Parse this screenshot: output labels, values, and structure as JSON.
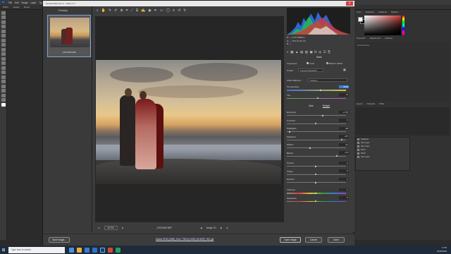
{
  "photoshop": {
    "logo": "Ps",
    "menu": [
      "File",
      "Edit",
      "Image",
      "Layer",
      "Type",
      "Select",
      "Filter",
      "3D",
      "View",
      "Window",
      "Help"
    ],
    "options": [
      "Width:",
      "Height:",
      "Resol.:"
    ],
    "window_buttons": [
      "—",
      "❐",
      "✕"
    ]
  },
  "dialog": {
    "title": "Camera Raw 11.4.1  ·  Nikon Z 7",
    "close": "✕",
    "filmstrip_label": "Filmstrip",
    "thumb_name": "_DSC0263.NEF",
    "toolbar_icons": [
      "zoom-icon",
      "hand-icon",
      "white-balance-icon",
      "color-sampler-icon",
      "target-adjust-icon",
      "crop-icon",
      "straighten-icon",
      "transform-icon",
      "spot-removal-icon",
      "red-eye-icon",
      "adjustment-brush-icon",
      "graduated-filter-icon",
      "radial-filter-icon",
      "preferences-icon",
      "rotate-left-icon",
      "rotate-right-icon"
    ],
    "zoom_value": "30.9%",
    "file_name": "_DSC0263.NEF",
    "image_counter": "Image 1/1",
    "workflow_link": "Adobe RGB (1998); 8 bit; 7789 by 5189 (40.4MP); 300 ppi",
    "buttons": {
      "save": "Save Image...",
      "open": "Open Image",
      "cancel": "Cancel",
      "done": "Done"
    }
  },
  "panel": {
    "readout": [
      "R:  ---    f/1.8    1/8000 s",
      "G:  ---    ISO 31    20 mm",
      "B:  ---"
    ],
    "section": "Basic",
    "treatment_label": "Treatment:",
    "treatment_color": "Color",
    "treatment_bw": "Black & White",
    "profile_label": "Profile:",
    "profile_value": "Camera Standard",
    "wb_label": "White Balance:",
    "wb_value": "Custom",
    "auto": "Auto",
    "default": "Default",
    "sliders_top": [
      {
        "label": "Temperature",
        "value": "6150",
        "pos": 0.58
      },
      {
        "label": "Tint",
        "value": "+6",
        "pos": 0.53
      }
    ],
    "sliders_tone": [
      {
        "label": "Exposure",
        "value": "+1.35",
        "pos": 0.62
      },
      {
        "label": "Contrast",
        "value": "0",
        "pos": 0.5
      },
      {
        "label": "Highlights",
        "value": "-96",
        "pos": 0.05
      },
      {
        "label": "Shadows",
        "value": "+87",
        "pos": 0.93
      },
      {
        "label": "Whites",
        "value": "-21",
        "pos": 0.4
      },
      {
        "label": "Blacks",
        "value": "+70",
        "pos": 0.85
      }
    ],
    "sliders_presence": [
      {
        "label": "Texture",
        "value": "0",
        "pos": 0.5
      },
      {
        "label": "Clarity",
        "value": "0",
        "pos": 0.5
      },
      {
        "label": "Dehaze",
        "value": "0",
        "pos": 0.5
      }
    ],
    "sliders_color": [
      {
        "label": "Vibrance",
        "value": "0",
        "pos": 0.5
      },
      {
        "label": "Saturation",
        "value": "0",
        "pos": 0.5
      }
    ]
  },
  "ps_panels": {
    "tabs_top": [
      "Color",
      "Swatches",
      "Gradients",
      "Patterns"
    ],
    "tabs_props": [
      "Properties",
      "Adjustments",
      "Libraries"
    ],
    "props_text": "No Properties",
    "tabs_layers": [
      "Layers",
      "Channels",
      "Paths"
    ],
    "history": [
      "Snapshot",
      "New Layer",
      "New Layer",
      "Brush",
      "Brush",
      "New Layer"
    ]
  },
  "taskbar": {
    "search": "Type here to search",
    "time": "17:55",
    "date": "18/06/2020"
  }
}
